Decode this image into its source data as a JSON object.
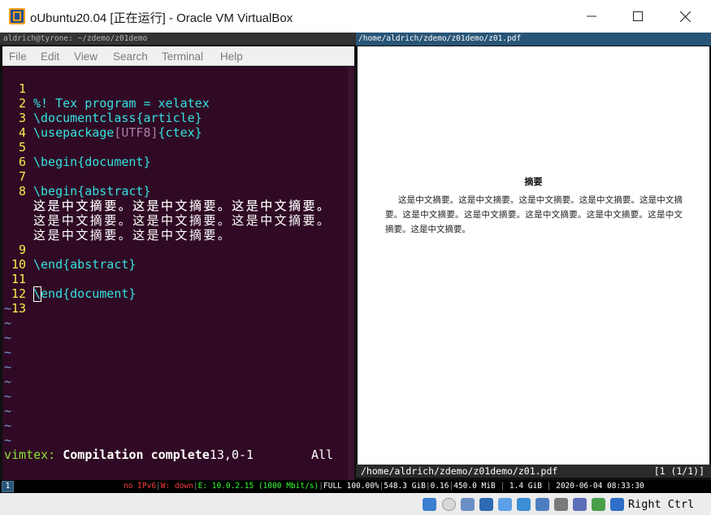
{
  "window": {
    "title": "oUbuntu20.04 [正在运行] - Oracle VM VirtualBox",
    "app_icon": "virtualbox-icon",
    "controls": [
      "minimize-icon",
      "maximize-icon",
      "close-icon"
    ]
  },
  "terminal": {
    "title": "aldrich@tyrone: ~/zdemo/z01demo",
    "menu": [
      "File",
      "Edit",
      "View",
      "Search",
      "Terminal",
      "Help"
    ],
    "lines": [
      {
        "num": "1",
        "text": "%! Tex program = xelatex"
      },
      {
        "num": "2",
        "cmd": "\\documentclass",
        "arg": "{article}"
      },
      {
        "num": "3",
        "cmd": "\\usepackage",
        "opt": "[UTF8]",
        "arg": "{ctex}"
      },
      {
        "num": "4",
        "text": ""
      },
      {
        "num": "5",
        "cmd": "\\begin",
        "arg": "{document}"
      },
      {
        "num": "6",
        "text": ""
      },
      {
        "num": "7",
        "cmd": "\\begin",
        "arg": "{abstract}"
      },
      {
        "num": "8",
        "wrapped": [
          "这是中文摘要。这是中文摘要。这是中文摘要。",
          "这是中文摘要。这是中文摘要。这是中文摘要。",
          "这是中文摘要。这是中文摘要。这是中文摘要。",
          "这是中文摘要。这是中文摘要。"
        ]
      },
      {
        "num": "9",
        "cmd": "\\end",
        "arg": "{abstract}"
      },
      {
        "num": "10",
        "text": ""
      },
      {
        "num": "11",
        "cmd": "\\end",
        "arg": "{document}"
      },
      {
        "num": "12",
        "text": ""
      },
      {
        "num": "13",
        "text": ""
      }
    ],
    "empty_marker": "~",
    "status": {
      "prefix": "vimtex:",
      "message": "Compilation complete",
      "position": "13,0-1",
      "scroll": "All"
    }
  },
  "pdf": {
    "path": "/home/aldrich/zdemo/z01demo/z01.pdf",
    "abstract_title": "摘要",
    "abstract_text": "这是中文摘要。这是中文摘要。这是中文摘要。这是中文摘要。这是中文摘要。这是中文摘要。这是中文摘要。这是中文摘要。这是中文摘要。这是中文摘要。这是中文摘要。",
    "page_indicator": "[1 (1/1)]"
  },
  "i3bar": {
    "workspace": "1",
    "ipv6": "no IPv6",
    "wireless": "W: down",
    "ethernet": "E: 10.0.2.15 (1000 Mbit/s)",
    "battery": "FULL 100.00%",
    "disk": "548.3 GiB",
    "load": "0.16",
    "memory": "450.0 MiB",
    "swap": "1.4 GiB",
    "datetime": "2020-06-04 08:33:30",
    "separator": "|"
  },
  "hostbar": {
    "icons": [
      "hard-disk-icon",
      "optical-disk-icon",
      "audio-icon",
      "network-icon",
      "usb-icon",
      "shared-folder-icon",
      "display-icon",
      "recording-icon",
      "virtualization-icon",
      "mouse-integration-icon",
      "keyboard-icon"
    ],
    "host_key": "Right Ctrl"
  },
  "colors": {
    "terminal_bg": "#300a24",
    "line_number": "#fce94f",
    "latex_command": "#34e2e2",
    "latex_option": "#ad7fa8",
    "tilde": "#729fcf",
    "i3_focused": "#285577"
  }
}
